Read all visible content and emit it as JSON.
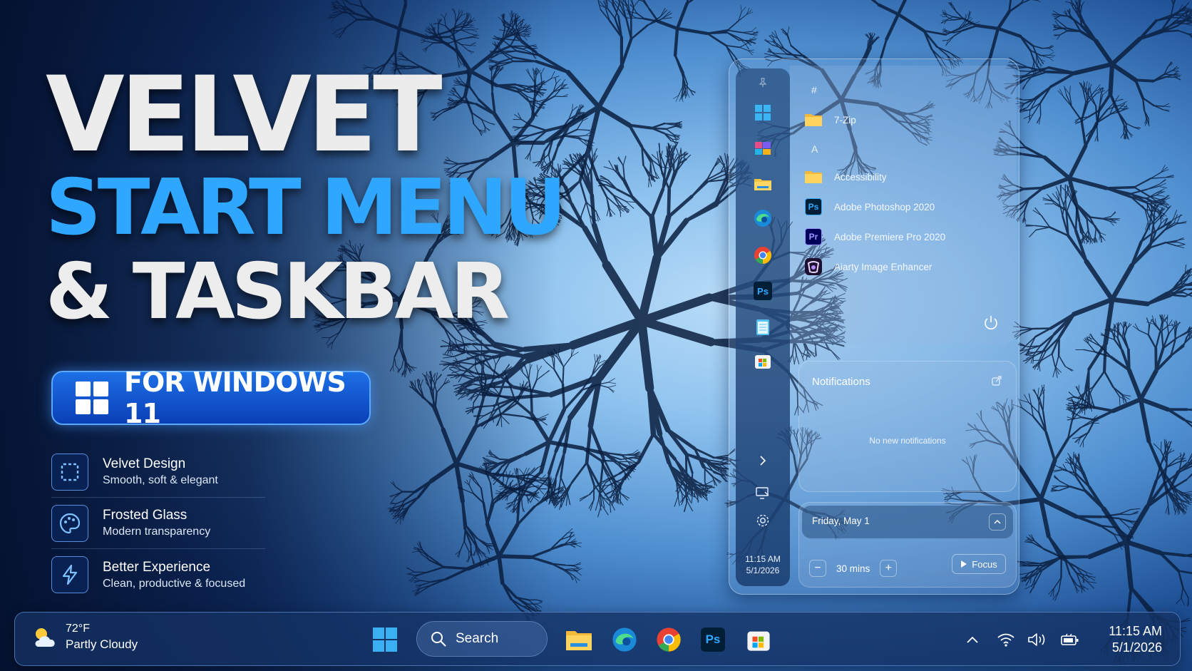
{
  "hero": {
    "line1": "VELVET",
    "line2": "START MENU",
    "line3": "& TASKBAR",
    "badge": "FOR WINDOWS 11",
    "features": [
      {
        "title": "Velvet Design",
        "subtitle": "Smooth, soft & elegant",
        "icon": "dashed-square-icon"
      },
      {
        "title": "Frosted Glass",
        "subtitle": "Modern transparency",
        "icon": "palette-icon"
      },
      {
        "title": "Better Experience",
        "subtitle": "Clean, productive & focused",
        "icon": "lightning-icon"
      }
    ]
  },
  "start_menu": {
    "rail_icons": [
      "pin-icon",
      "windows-icon",
      "color-app-icon",
      "file-explorer-icon",
      "edge-icon",
      "chrome-icon",
      "photoshop-icon",
      "notepad-icon",
      "store-icon"
    ],
    "sections": [
      {
        "letter": "#",
        "apps": [
          {
            "name": "7-Zip",
            "icon": "folder-icon"
          }
        ]
      },
      {
        "letter": "A",
        "apps": [
          {
            "name": "Accessibility",
            "icon": "folder-icon"
          },
          {
            "name": "Adobe Photoshop 2020",
            "icon": "photoshop-icon",
            "abbr": "Ps"
          },
          {
            "name": "Adobe Premiere Pro 2020",
            "icon": "premiere-icon",
            "abbr": "Pr"
          },
          {
            "name": "Aiarty Image Enhancer",
            "icon": "aiarty-icon"
          }
        ]
      }
    ],
    "rail_time": "11:15 AM",
    "rail_date": "5/1/2026",
    "ps_abbr": "Ps"
  },
  "notifications": {
    "title": "Notifications",
    "empty_text": "No new notifications"
  },
  "calendar": {
    "date": "Friday, May 1",
    "timer": "30 mins",
    "focus_label": "Focus",
    "minus": "−",
    "plus": "+"
  },
  "taskbar": {
    "weather_temp": "72°F",
    "weather_cond": "Partly Cloudy",
    "search_label": "Search",
    "ps_abbr": "Ps",
    "time": "11:15 AM",
    "date": "5/1/2026"
  },
  "colors": {
    "accent": "#2fa7ff",
    "badge": "#1d6fe6",
    "taskbar": "#14326a"
  }
}
